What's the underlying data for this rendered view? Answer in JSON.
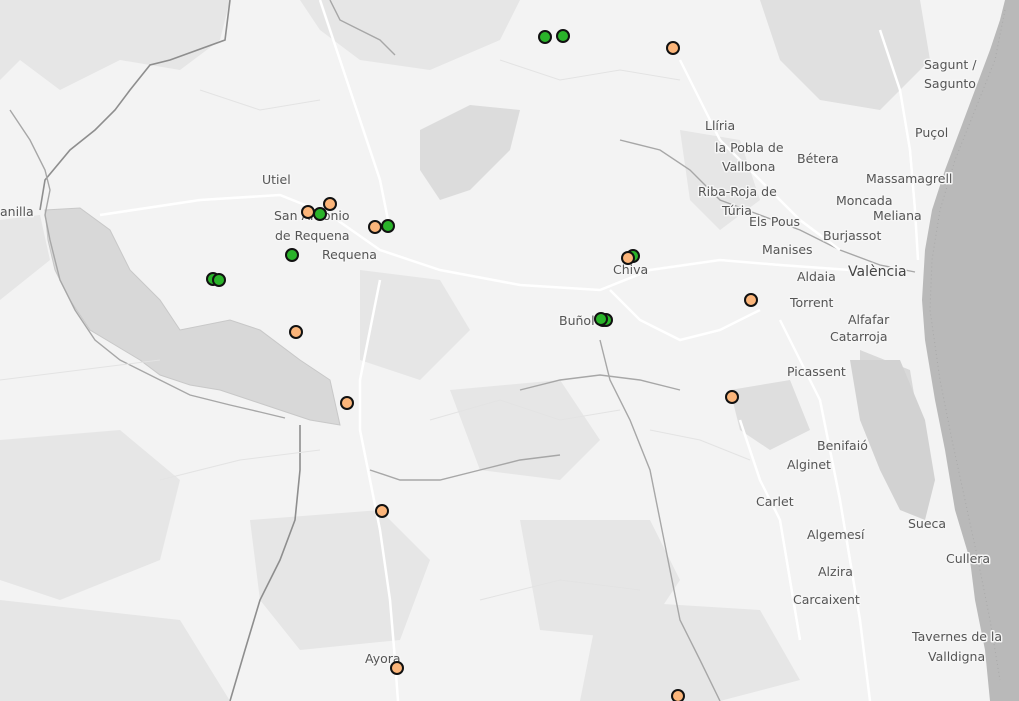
{
  "colors": {
    "background": "#f2f2f2",
    "land_light": "#f7f7f7",
    "relief": "#e4e4e4",
    "reservoir": "#d7d7d7",
    "sea": "#b8b8b8",
    "road": "#ffffff",
    "border": "#9a9a9a",
    "river": "#a8a8a8",
    "label": "#555555",
    "marker_green": "#2ab32a",
    "marker_orange": "#fbb57a",
    "marker_stroke": "#111111"
  },
  "places": [
    {
      "id": "sagunt",
      "text": "Sagunt /"
    },
    {
      "id": "sagunto",
      "text": "Sagunto"
    },
    {
      "id": "pucol",
      "text": "Puçol"
    },
    {
      "id": "lliria",
      "text": "Llíria"
    },
    {
      "id": "pobla",
      "text": "la Pobla de"
    },
    {
      "id": "vallbona",
      "text": "Vallbona"
    },
    {
      "id": "betera",
      "text": "Bétera"
    },
    {
      "id": "massamagrell",
      "text": "Massamagrell"
    },
    {
      "id": "ribaroja",
      "text": "Riba-Roja de"
    },
    {
      "id": "turia",
      "text": "Túria"
    },
    {
      "id": "moncada",
      "text": "Moncada"
    },
    {
      "id": "meliana",
      "text": "Meliana"
    },
    {
      "id": "elspous",
      "text": "Els Pous"
    },
    {
      "id": "burjassot",
      "text": "Burjassot"
    },
    {
      "id": "manises",
      "text": "Manises"
    },
    {
      "id": "aldaia",
      "text": "Aldaia"
    },
    {
      "id": "valencia",
      "text": "València"
    },
    {
      "id": "torrent",
      "text": "Torrent"
    },
    {
      "id": "alfafar",
      "text": "Alfafar"
    },
    {
      "id": "catarroja",
      "text": "Catarroja"
    },
    {
      "id": "picassent",
      "text": "Picassent"
    },
    {
      "id": "benifaio",
      "text": "Benifaió"
    },
    {
      "id": "alginet",
      "text": "Alginet"
    },
    {
      "id": "carlet",
      "text": "Carlet"
    },
    {
      "id": "algemesi",
      "text": "Algemesí"
    },
    {
      "id": "sueca",
      "text": "Sueca"
    },
    {
      "id": "cullera",
      "text": "Cullera"
    },
    {
      "id": "alzira",
      "text": "Alzira"
    },
    {
      "id": "carcaixent",
      "text": "Carcaixent"
    },
    {
      "id": "tavernes1",
      "text": "Tavernes de la"
    },
    {
      "id": "tavernes2",
      "text": "Valldigna"
    },
    {
      "id": "utiel",
      "text": "Utiel"
    },
    {
      "id": "sanantonio1",
      "text": "San Antonio"
    },
    {
      "id": "sanantonio2",
      "text": "de Requena"
    },
    {
      "id": "requena",
      "text": "Requena"
    },
    {
      "id": "chiva",
      "text": "Chiva"
    },
    {
      "id": "bunol",
      "text": "Buñol"
    },
    {
      "id": "ayora",
      "text": "Ayora"
    },
    {
      "id": "nilla",
      "text": "anilla"
    }
  ],
  "markers": [
    {
      "color": "green",
      "label": "marker-1"
    },
    {
      "color": "green",
      "label": "marker-2"
    },
    {
      "color": "orange",
      "label": "marker-3"
    },
    {
      "color": "orange",
      "label": "marker-4"
    },
    {
      "color": "orange",
      "label": "marker-5"
    },
    {
      "color": "green",
      "label": "marker-6"
    },
    {
      "color": "orange",
      "label": "marker-7"
    },
    {
      "color": "green",
      "label": "marker-8"
    },
    {
      "color": "green",
      "label": "marker-9"
    },
    {
      "color": "green",
      "label": "marker-10"
    },
    {
      "color": "green",
      "label": "marker-11"
    },
    {
      "color": "green",
      "label": "marker-12"
    },
    {
      "color": "orange",
      "label": "marker-13"
    },
    {
      "color": "orange",
      "label": "marker-14"
    },
    {
      "color": "orange",
      "label": "marker-15"
    },
    {
      "color": "orange",
      "label": "marker-16"
    },
    {
      "color": "orange",
      "label": "marker-17"
    },
    {
      "color": "orange",
      "label": "marker-18"
    },
    {
      "color": "orange",
      "label": "marker-19"
    },
    {
      "color": "orange",
      "label": "marker-20"
    },
    {
      "color": "orange",
      "label": "marker-21"
    },
    {
      "color": "green",
      "label": "marker-22"
    },
    {
      "color": "green",
      "label": "marker-23"
    }
  ]
}
